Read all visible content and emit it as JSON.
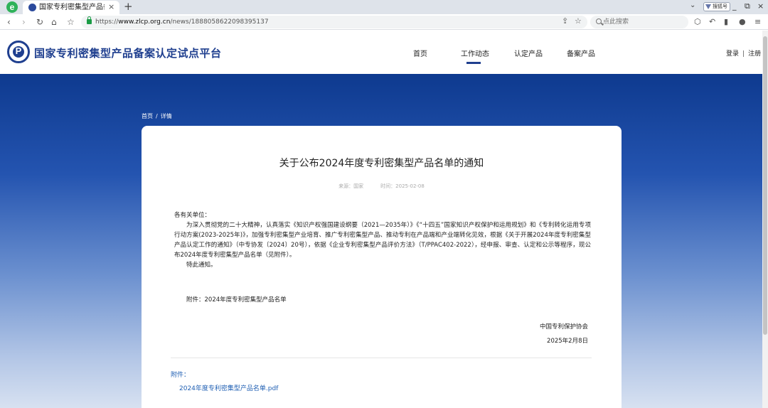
{
  "browser": {
    "logo_icon": "edge-e-icon",
    "tab": {
      "title": "国家专利密集型产品备案认",
      "close": "×",
      "favicon": "site-favicon"
    },
    "new_tab": "+",
    "profile": "搜狐号",
    "window": {
      "minimize": "_",
      "restore": "⧉",
      "close": "×"
    },
    "nav": {
      "back": "‹",
      "forward": "›",
      "reload": "↻",
      "home": "⌂",
      "bookmark": "☆"
    },
    "url": {
      "scheme": "https://",
      "host": "www.zlcp.org.cn",
      "path": "/news/1888058622098395137"
    },
    "search_placeholder": "点此搜索",
    "tools": {
      "share": "⇪",
      "star": "☆",
      "extensions": "⬡",
      "undo": "↶",
      "sidebar": "▮",
      "account": "●",
      "menu": "≡"
    }
  },
  "site": {
    "title": "国家专利密集型产品备案认定试点平台",
    "nav": [
      {
        "label": "首页"
      },
      {
        "label": "工作动态",
        "active": true
      },
      {
        "label": "认定产品"
      },
      {
        "label": "备案产品"
      }
    ],
    "auth": {
      "login": "登录",
      "separator": "|",
      "register": "注册"
    }
  },
  "breadcrumb": {
    "home": "首页",
    "separator": "/",
    "current": "详情"
  },
  "article": {
    "title": "关于公布2024年度专利密集型产品名单的通知",
    "meta": {
      "source": "来源：国家",
      "time": "时间：2025-02-08"
    },
    "salutation": "各有关单位：",
    "paragraph": "为深入贯彻党的二十大精神，认真落实《知识产权强国建设纲要（2021—2035年）》《“十四五”国家知识产权保护和运用规划》和《专利转化运用专项行动方案(2023-2025年)》，加强专利密集型产业培育、推广专利密集型产品、推动专利在产品端和产业端转化见效，根据《关于开展2024年度专利密集型产品认定工作的通知》（中专协发〔2024〕20号），依据《企业专利密集型产品评价方法》（T/PPAC402-2022），经申报、审查、认定和公示等程序，现公布2024年度专利密集型产品名单（见附件）。",
    "closing": "特此通知。",
    "attachment_note": "附件：2024年度专利密集型产品名单",
    "signature_org": "中国专利保护协会",
    "signature_date": "2025年2月8日",
    "attachments_label": "附件：",
    "attachment_file": "2024年度专利密集型产品名单.pdf"
  },
  "colors": {
    "brand": "#1f3f8f",
    "hero_top": "#0e3a8f",
    "hero_bottom": "#d7e1f1",
    "link": "#1f5fb3"
  }
}
